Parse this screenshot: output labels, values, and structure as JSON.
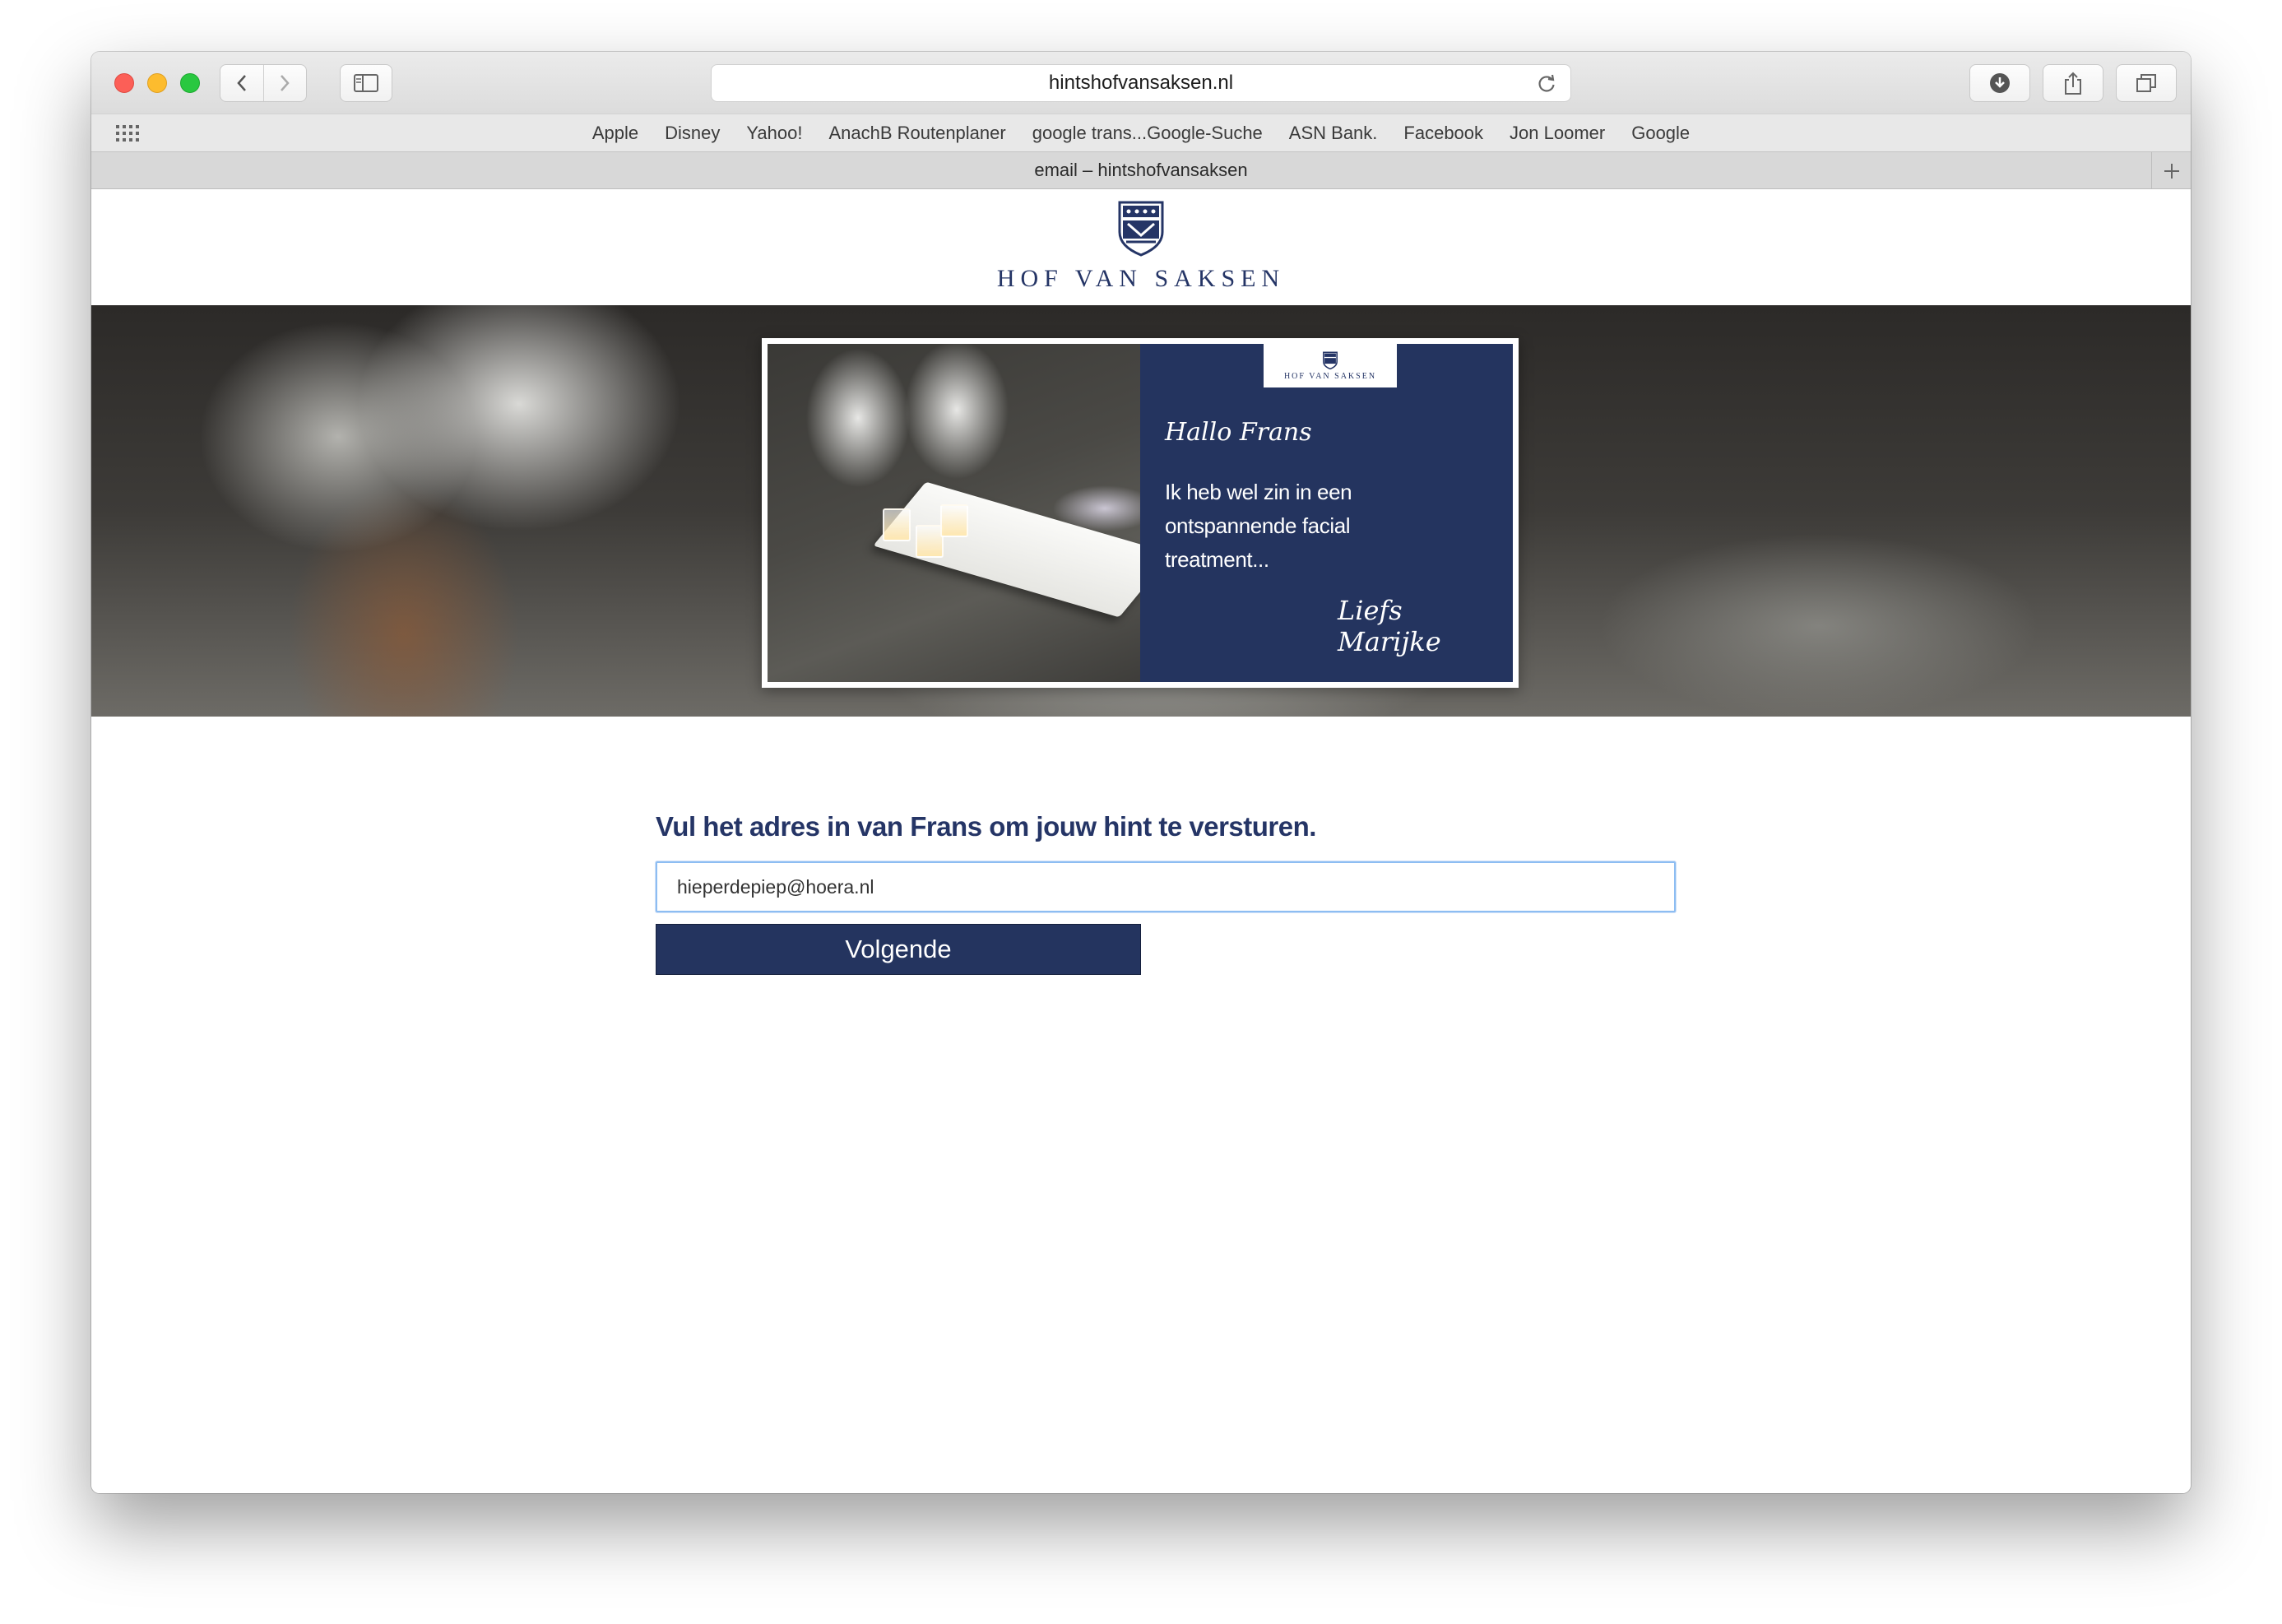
{
  "browser": {
    "address": "hintshofvansaksen.nl",
    "tab_title": "email – hintshofvansaksen",
    "bookmarks": [
      "Apple",
      "Disney",
      "Yahoo!",
      "AnachB Routenplaner",
      "google trans...Google-Suche",
      "ASN Bank.",
      "Facebook",
      "Jon Loomer",
      "Google"
    ]
  },
  "site": {
    "brand": "HOF VAN SAKSEN"
  },
  "hero_card": {
    "brand": "HOF VAN SAKSEN",
    "greeting": "Hallo Frans",
    "message": "Ik heb wel zin in een ontspannende facial treatment...",
    "signature": "Liefs Marijke"
  },
  "form": {
    "heading": "Vul het adres in van Frans om jouw hint te versturen.",
    "email_value": "hieperdepiep@hoera.nl",
    "submit_label": "Volgende"
  },
  "colors": {
    "brand_navy": "#24345f",
    "input_focus": "#8dbdf2"
  }
}
